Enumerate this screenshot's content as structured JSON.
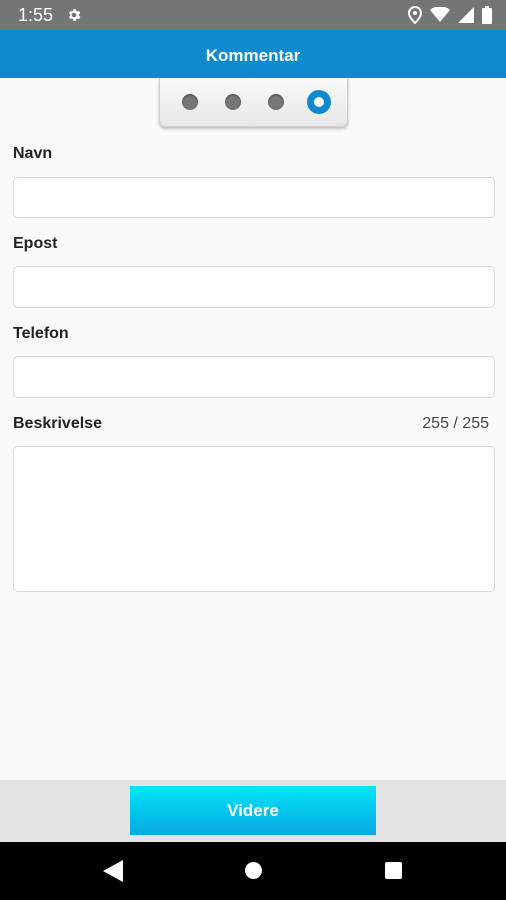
{
  "status_bar": {
    "time": "1:55",
    "icons": [
      "gear-icon",
      "location-icon",
      "wifi-icon",
      "signal-icon",
      "battery-icon"
    ]
  },
  "app_bar": {
    "title": "Kommentar"
  },
  "stepper": {
    "total_steps": 4,
    "current_step": 4
  },
  "form": {
    "name_label": "Navn",
    "name_value": "",
    "email_label": "Epost",
    "email_value": "",
    "phone_label": "Telefon",
    "phone_value": "",
    "description_label": "Beskrivelse",
    "description_value": "",
    "description_counter": "255 / 255"
  },
  "footer": {
    "next_label": "Videre"
  },
  "nav": {
    "icons": [
      "back-icon",
      "home-icon",
      "recents-icon"
    ]
  },
  "colors": {
    "primary": "#0f8ace",
    "button_top": "#00e6f8",
    "button_bottom": "#06a8e3"
  }
}
